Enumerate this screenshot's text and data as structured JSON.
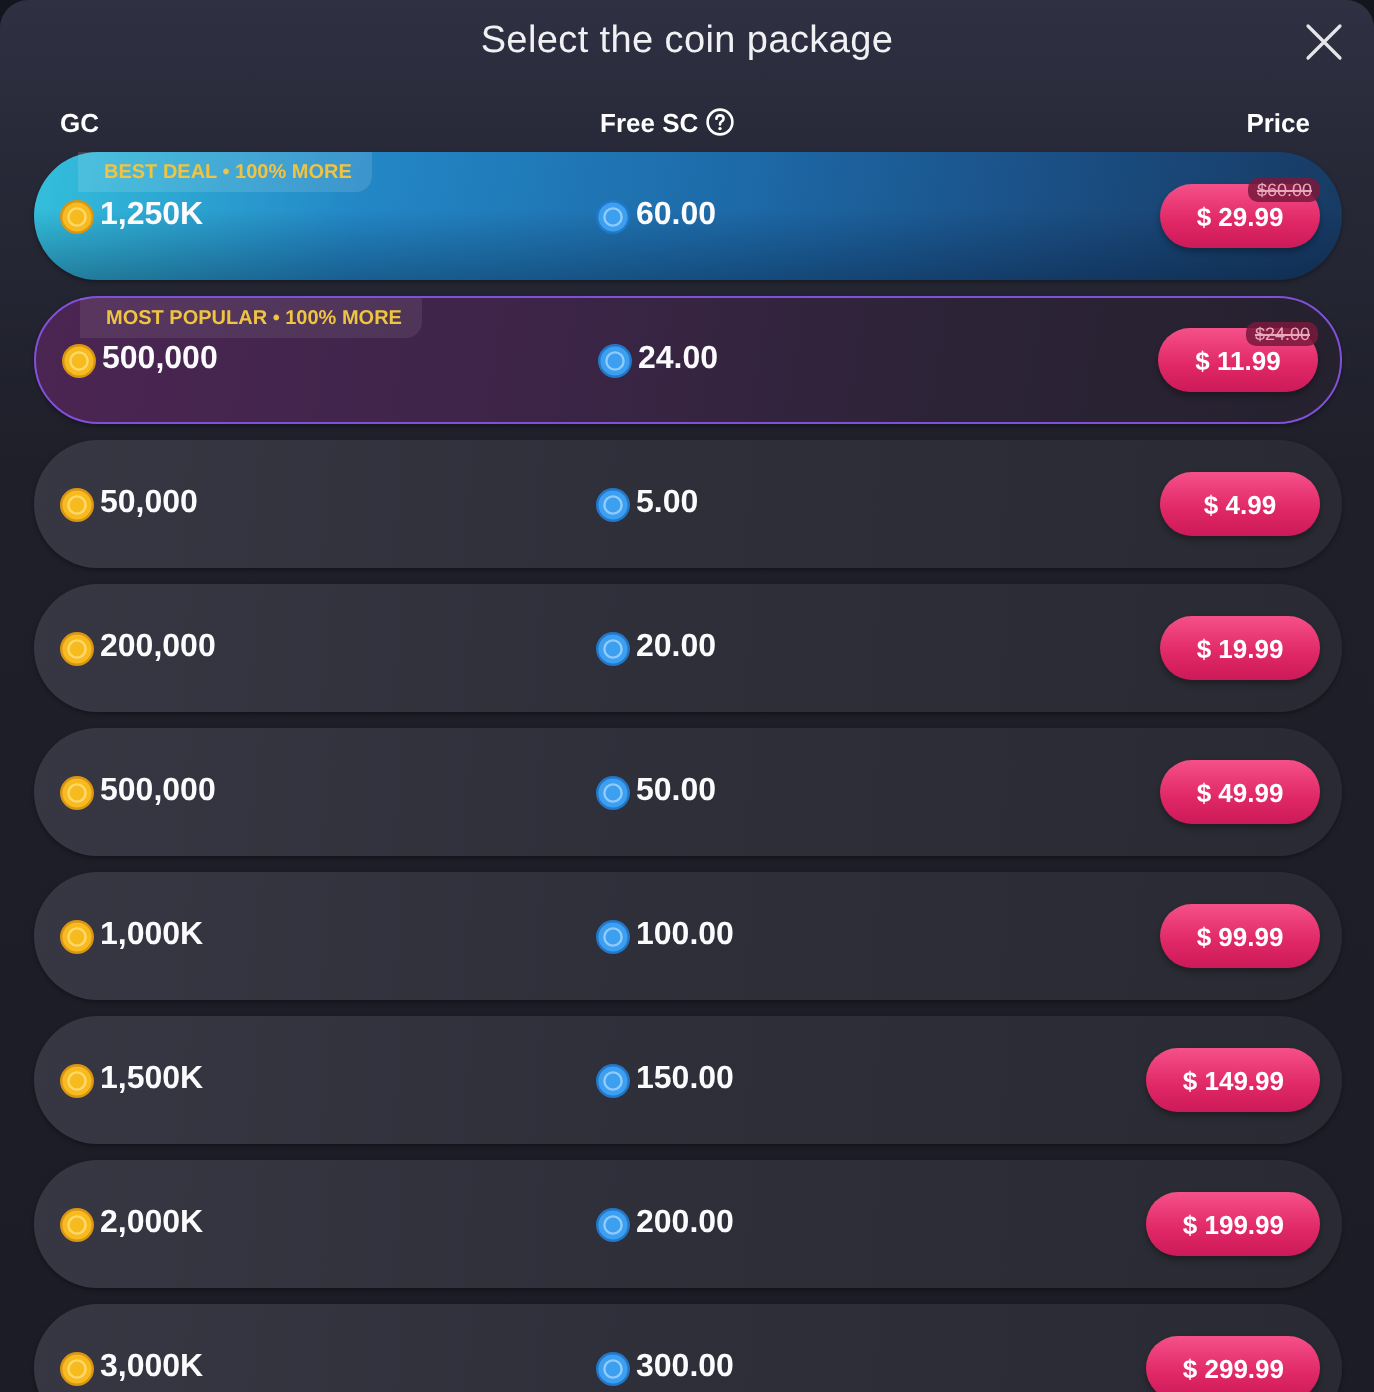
{
  "dialog": {
    "title": "Select the coin package"
  },
  "columns": [
    {
      "label": "GC",
      "kind": "plain"
    },
    {
      "label": "Free SC",
      "kind": "help"
    },
    {
      "label": "Price",
      "kind": "plain"
    }
  ],
  "packages": [
    {
      "kind": "best-deal",
      "badge": "BEST DEAL • 100% MORE",
      "gc": "1,250K",
      "sc": "60.00",
      "price": "$ 29.99",
      "old_price": "$60.00"
    },
    {
      "kind": "popular",
      "badge": "MOST POPULAR • 100% MORE",
      "gc": "500,000",
      "sc": "24.00",
      "price": "$ 11.99",
      "old_price": "$24.00"
    },
    {
      "kind": "standard",
      "gc": "50,000",
      "sc": "5.00",
      "price": "$ 4.99"
    },
    {
      "kind": "standard",
      "gc": "200,000",
      "sc": "20.00",
      "price": "$ 19.99"
    },
    {
      "kind": "standard",
      "gc": "500,000",
      "sc": "50.00",
      "price": "$ 49.99"
    },
    {
      "kind": "standard",
      "gc": "1,000K",
      "sc": "100.00",
      "price": "$ 99.99"
    },
    {
      "kind": "standard",
      "gc": "1,500K",
      "sc": "150.00",
      "price": "$ 149.99"
    },
    {
      "kind": "standard",
      "gc": "2,000K",
      "sc": "200.00",
      "price": "$ 199.99"
    },
    {
      "kind": "standard",
      "gc": "3,000K",
      "sc": "300.00",
      "price": "$ 299.99"
    }
  ]
}
